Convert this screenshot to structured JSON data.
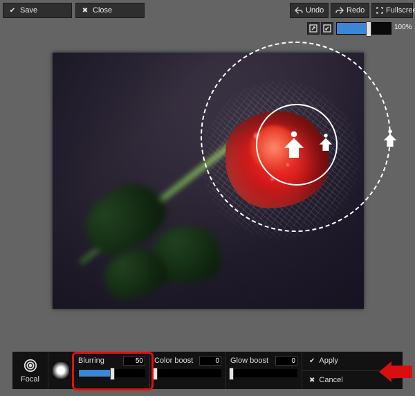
{
  "top": {
    "save": "Save",
    "close": "Close",
    "undo": "Undo",
    "redo": "Redo",
    "fullscreen": "Fullscreen",
    "zoom_percent": "100%"
  },
  "focal": {
    "tool_label": "Focal",
    "sliders": {
      "blurring": {
        "label": "Blurring",
        "value": "50",
        "fill_pct": 50
      },
      "colorboost": {
        "label": "Color boost",
        "value": "0",
        "fill_pct": 0
      },
      "glowboost": {
        "label": "Glow boost",
        "value": "0",
        "fill_pct": 0
      }
    },
    "apply": "Apply",
    "cancel": "Cancel"
  },
  "highlight": "blurring",
  "colors": {
    "accent": "#3a87d6",
    "highlight": "#e20f0f"
  }
}
